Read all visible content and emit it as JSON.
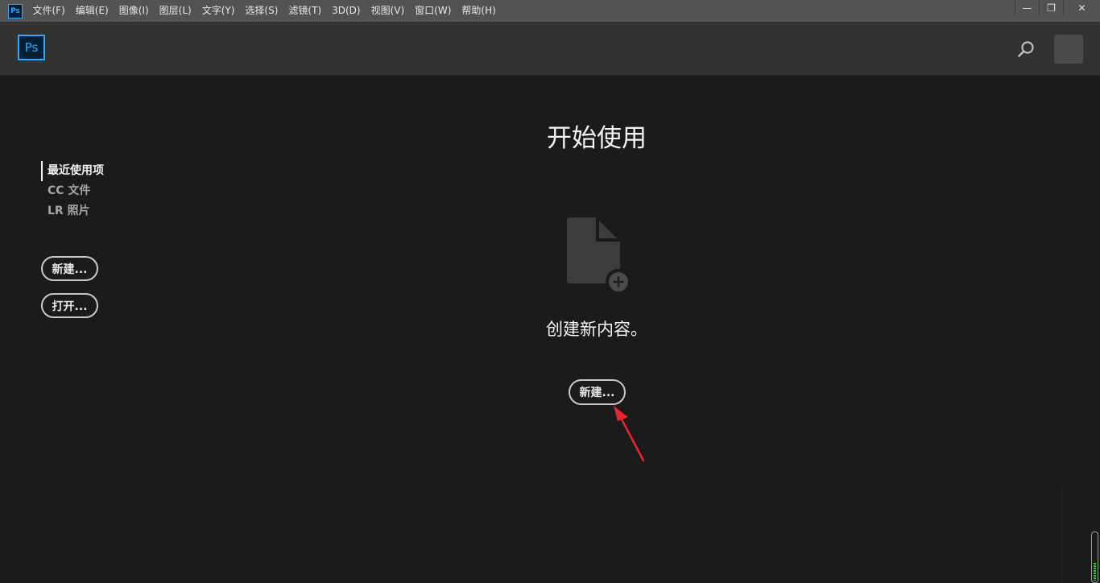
{
  "menubar": {
    "app_icon": "Ps",
    "items": [
      "文件(F)",
      "编辑(E)",
      "图像(I)",
      "图层(L)",
      "文字(Y)",
      "选择(S)",
      "滤镜(T)",
      "3D(D)",
      "视图(V)",
      "窗口(W)",
      "帮助(H)"
    ],
    "window_controls": {
      "minimize": "—",
      "restore": "❐",
      "close": "✕"
    }
  },
  "header": {
    "logo": "Ps",
    "icons": [
      "search-icon",
      "account-avatar"
    ]
  },
  "sidebar": {
    "nav": [
      {
        "label": "最近使用项",
        "active": true
      },
      {
        "label": "CC 文件",
        "active": false
      },
      {
        "label": "LR 照片",
        "active": false
      }
    ],
    "new_label": "新建...",
    "open_label": "打开..."
  },
  "main": {
    "title": "开始使用",
    "subtitle": "创建新内容。",
    "new_label": "新建...",
    "icon": "new-document-icon"
  },
  "colors": {
    "background": "#1b1b1b",
    "menubar": "#535353",
    "header": "#323232",
    "ps_blue": "#31a8ff",
    "annotation_red": "#e8262b"
  }
}
